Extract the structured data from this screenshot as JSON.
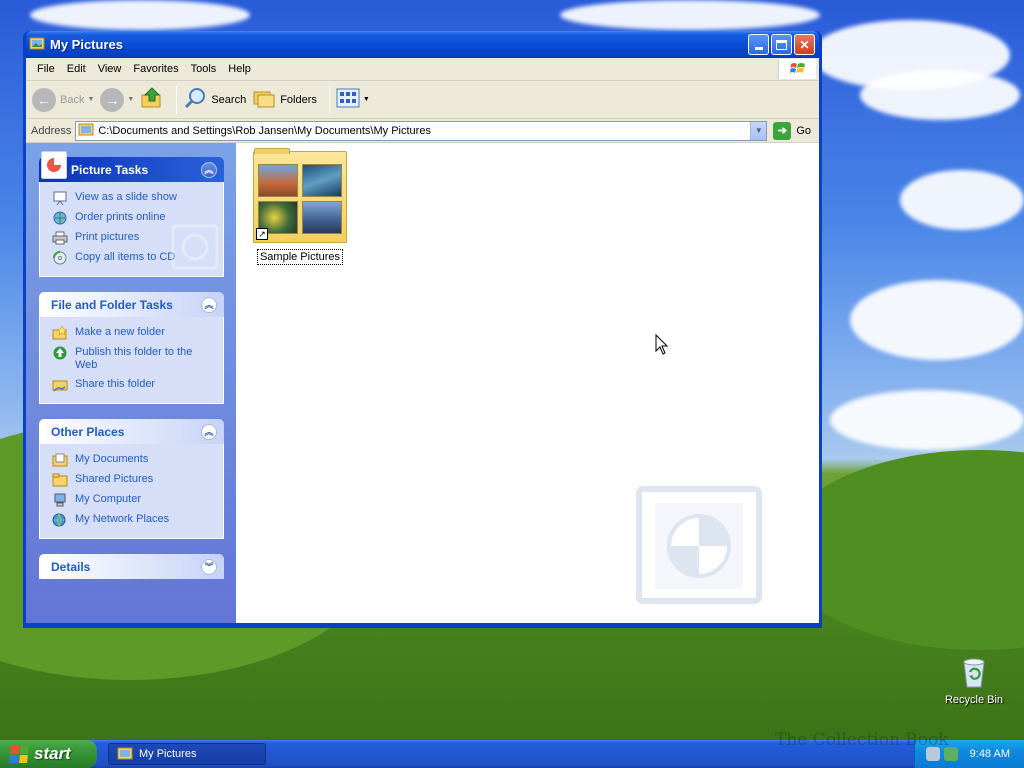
{
  "window": {
    "title": "My Pictures"
  },
  "menubar": {
    "items": [
      "File",
      "Edit",
      "View",
      "Favorites",
      "Tools",
      "Help"
    ]
  },
  "toolbar": {
    "back_label": "Back",
    "search_label": "Search",
    "folders_label": "Folders"
  },
  "addressbar": {
    "label": "Address",
    "path": "C:\\Documents and Settings\\Rob Jansen\\My Documents\\My Pictures",
    "go_label": "Go"
  },
  "taskpane": {
    "picture_tasks": {
      "title": "Picture Tasks",
      "items": [
        "View as a slide show",
        "Order prints online",
        "Print pictures",
        "Copy all items to CD"
      ]
    },
    "file_folder_tasks": {
      "title": "File and Folder Tasks",
      "items": [
        "Make a new folder",
        "Publish this folder to the Web",
        "Share this folder"
      ]
    },
    "other_places": {
      "title": "Other Places",
      "items": [
        "My Documents",
        "Shared Pictures",
        "My Computer",
        "My Network Places"
      ]
    },
    "details": {
      "title": "Details"
    }
  },
  "content": {
    "items": [
      {
        "label": "Sample Pictures",
        "icon": "folder-with-thumbnails-icon"
      }
    ]
  },
  "desktop": {
    "recycle_bin_label": "Recycle Bin"
  },
  "taskbar": {
    "start_label": "start",
    "window_button_label": "My Pictures",
    "clock": "9:48 AM",
    "watermark_text": "The Collection Book"
  },
  "colors": {
    "titlebar": "#0a4bd6",
    "taskpane_link": "#215dc6",
    "start_green": "#3c9a3c",
    "tray_blue": "#0f8ae0"
  }
}
